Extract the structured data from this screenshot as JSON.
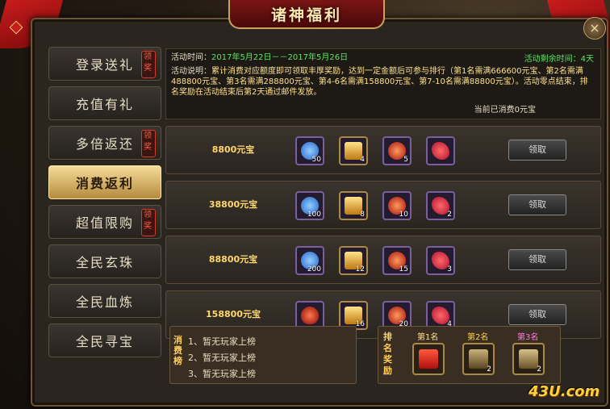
{
  "window": {
    "title": "诸神福利",
    "close_label": "×"
  },
  "sidebar": {
    "items": [
      {
        "label": "登录送礼",
        "badge": "领奖"
      },
      {
        "label": "充值有礼",
        "badge": ""
      },
      {
        "label": "多倍返还",
        "badge": "领奖"
      },
      {
        "label": "消费返利",
        "badge": ""
      },
      {
        "label": "超值限购",
        "badge": "领奖"
      },
      {
        "label": "全民玄珠",
        "badge": ""
      },
      {
        "label": "全民血炼",
        "badge": ""
      },
      {
        "label": "全民寻宝",
        "badge": ""
      }
    ]
  },
  "info": {
    "time_label": "活动时间：",
    "time_value": "2017年5月22日－－2017年5月26日",
    "remain": "活动剩余时间：4天",
    "desc_label": "活动说明：",
    "desc_text": "累计消费对应额度即可领取丰厚奖励，达到一定金额后可参与排行（第1名需满666600元宝、第2名需满488800元宝、第3名需满288800元宝、第4-6名需满158800元宝、第7-10名需满88800元宝）。活动零点结束，排名奖励在活动结束后第2天通过邮件发放。",
    "current": "当前已消费0元宝"
  },
  "rows": [
    {
      "amount": "8800元宝",
      "counts": [
        "50",
        "4",
        "5",
        ""
      ],
      "claim": "领取"
    },
    {
      "amount": "38800元宝",
      "counts": [
        "100",
        "8",
        "10",
        "2"
      ],
      "claim": "领取"
    },
    {
      "amount": "88800元宝",
      "counts": [
        "200",
        "12",
        "15",
        "3"
      ],
      "claim": "领取"
    },
    {
      "amount": "158800元宝",
      "counts": [
        "",
        "16",
        "20",
        "4"
      ],
      "claim": "领取"
    }
  ],
  "ranking": {
    "title": "消费榜",
    "lines": [
      "1、暂无玩家上榜",
      "2、暂无玩家上榜",
      "3、暂无玩家上榜"
    ]
  },
  "prizes": {
    "title": "排名奖励",
    "labels": [
      "第1名",
      "第2名",
      "第3名"
    ],
    "label_colors": [
      "#ffe08a",
      "#ffd24a",
      "#ff7adf"
    ],
    "counts": [
      "",
      "2",
      "2"
    ]
  },
  "logo": "43U.com"
}
